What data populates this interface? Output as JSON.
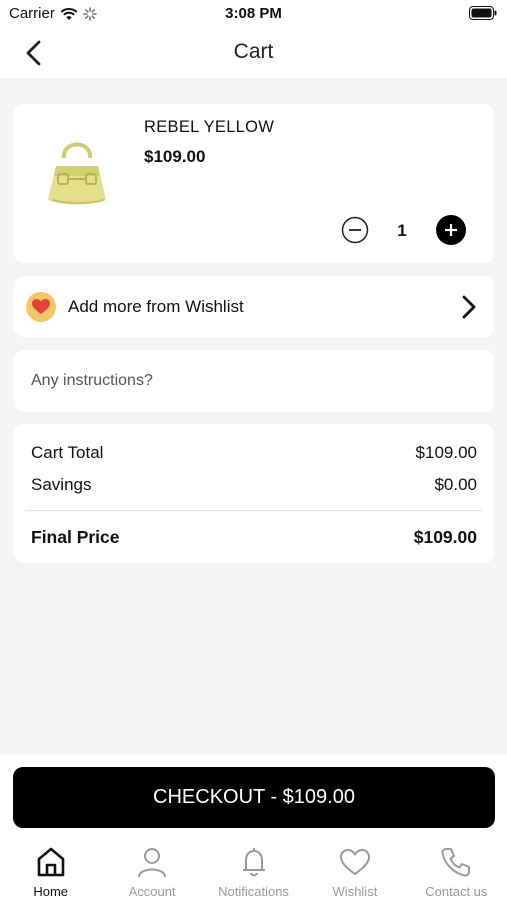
{
  "status_bar": {
    "carrier": "Carrier",
    "time": "3:08 PM"
  },
  "header": {
    "title": "Cart",
    "back_icon": "chevron-left-icon"
  },
  "cart_item": {
    "name": "REBEL YELLOW",
    "price": "$109.00",
    "quantity": "1",
    "image_icon": "yellow-handbag"
  },
  "wishlist": {
    "label": "Add more from Wishlist",
    "icon": "heart-icon"
  },
  "instructions": {
    "placeholder": "Any instructions?",
    "value": ""
  },
  "summary": {
    "cart_total_label": "Cart Total",
    "cart_total_value": "$109.00",
    "savings_label": "Savings",
    "savings_value": "$0.00",
    "final_label": "Final Price",
    "final_value": "$109.00"
  },
  "checkout": {
    "label": "CHECKOUT - $109.00"
  },
  "tabs": [
    {
      "label": "Home",
      "icon": "home-icon",
      "active": true
    },
    {
      "label": "Account",
      "icon": "user-icon",
      "active": false
    },
    {
      "label": "Notifications",
      "icon": "bell-icon",
      "active": false
    },
    {
      "label": "Wishlist",
      "icon": "heart-icon",
      "active": false
    },
    {
      "label": "Contact us",
      "icon": "phone-icon",
      "active": false
    }
  ],
  "colors": {
    "accent": "#000000",
    "background": "#f4f4f4",
    "heart_badge": "#f4c764",
    "heart": "#e4413a",
    "product": "#dfdc84"
  }
}
